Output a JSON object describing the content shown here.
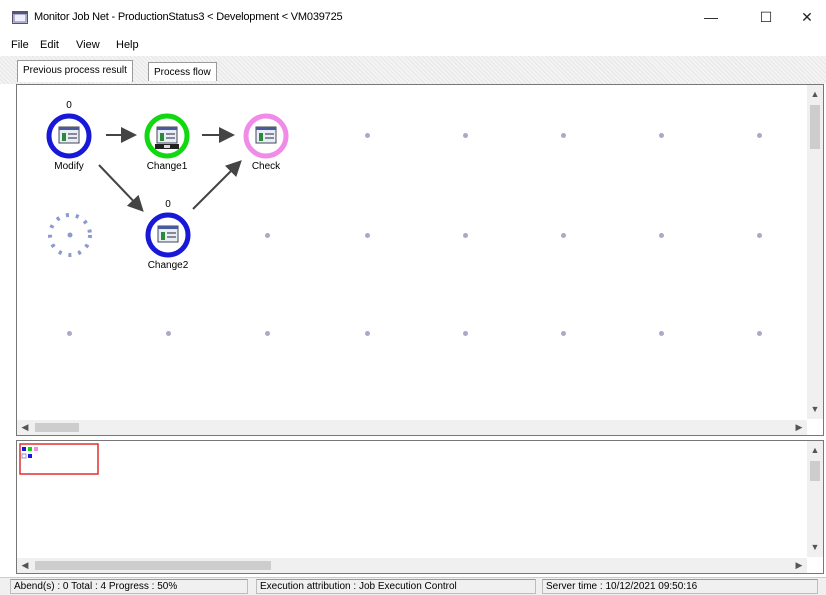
{
  "window": {
    "title": "Monitor Job Net - ProductionStatus3 < Development < VM039725",
    "minimize_glyph": "—",
    "maximize_glyph": "☐",
    "close_glyph": "✕"
  },
  "menu": {
    "file": "File",
    "edit": "Edit",
    "view": "View",
    "help": "Help"
  },
  "tabs": [
    {
      "label": "Previous process result",
      "active": true
    },
    {
      "label": "Process flow",
      "active": false
    }
  ],
  "nodes": {
    "modify": {
      "label": "Modify",
      "count": "0",
      "status_color": "#1818d8"
    },
    "change1": {
      "label": "Change1",
      "count": "",
      "status_color": "#12d812"
    },
    "check": {
      "label": "Check",
      "count": "",
      "status_color": "#f08ce8"
    },
    "change2": {
      "label": "Change2",
      "count": "0",
      "status_color": "#1818d8"
    }
  },
  "placeholder_color": "#8c9ad2",
  "grid_dot_color": "#a9a9c8",
  "status": {
    "progress": "Abend(s) : 0 Total : 4 Progress : 50%",
    "execution": "Execution attribution : Job Execution Control",
    "server_time": "Server time : 10/12/2021 09:50:16"
  },
  "icons": {
    "app": "monitor-app-icon",
    "job": "job-window-icon",
    "minimize": "minimize-icon",
    "maximize": "maximize-icon",
    "close": "close-icon"
  }
}
